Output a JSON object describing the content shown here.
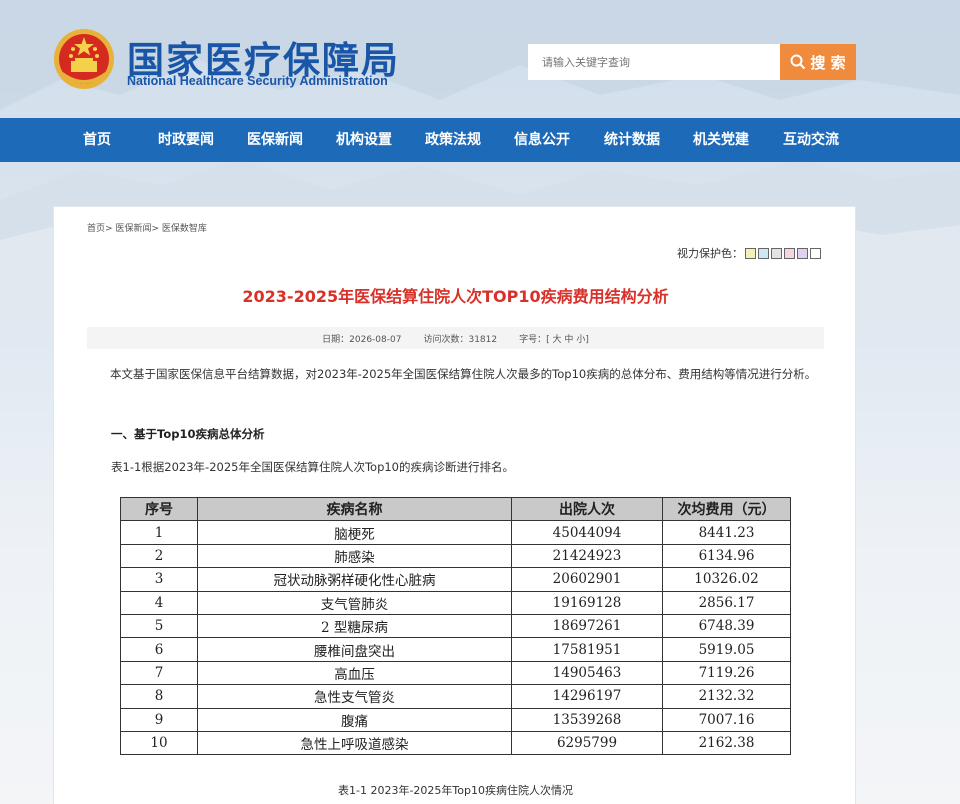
{
  "header": {
    "logo_cn": "国家医疗保障局",
    "logo_en": "National Healthcare Security Administration",
    "search_placeholder": "请输入关键字查询",
    "search_button": "搜 索"
  },
  "nav": {
    "items": [
      {
        "label": "首页"
      },
      {
        "label": "时政要闻"
      },
      {
        "label": "医保新闻"
      },
      {
        "label": "机构设置"
      },
      {
        "label": "政策法规"
      },
      {
        "label": "信息公开"
      },
      {
        "label": "统计数据"
      },
      {
        "label": "机关党建"
      },
      {
        "label": "互动交流"
      }
    ]
  },
  "breadcrumb": {
    "items": [
      "首页",
      "医保新闻",
      "医保数智库"
    ],
    "separator": ">"
  },
  "eye_care": {
    "label": "视力保护色：",
    "colors": [
      "#f5f0b8",
      "#cfe6f3",
      "#e3e3e3",
      "#f5d5e0",
      "#e2d0f0",
      "#ffffff"
    ]
  },
  "article": {
    "title": "2023-2025年医保结算住院人次TOP10疾病费用结构分析",
    "date_label": "日期：",
    "date": "2026-08-07",
    "visits_label": "访问次数：",
    "visits": "31812",
    "font_label": "字号：",
    "font_open": "[",
    "font_sizes": [
      "大",
      "中",
      "小"
    ],
    "font_close": "]",
    "intro": "本文基于国家医保信息平台结算数据，对2023年-2025年全国医保结算住院人次最多的Top10疾病的总体分布、费用结构等情况进行分析。",
    "section1": "一、基于Top10疾病总体分析",
    "table_intro": "表1-1根据2023年-2025年全国医保结算住院人次Top10的疾病诊断进行排名。",
    "table": {
      "headers": [
        "序号",
        "疾病名称",
        "出院人次",
        "次均费用（元）"
      ],
      "rows": [
        [
          "1",
          "脑梗死",
          "45044094",
          "8441.23"
        ],
        [
          "2",
          "肺感染",
          "21424923",
          "6134.96"
        ],
        [
          "3",
          "冠状动脉粥样硬化性心脏病",
          "20602901",
          "10326.02"
        ],
        [
          "4",
          "支气管肺炎",
          "19169128",
          "2856.17"
        ],
        [
          "5",
          "2 型糖尿病",
          "18697261",
          "6748.39"
        ],
        [
          "6",
          "腰椎间盘突出",
          "17581951",
          "5919.05"
        ],
        [
          "7",
          "高血压",
          "14905463",
          "7119.26"
        ],
        [
          "8",
          "急性支气管炎",
          "14296197",
          "2132.32"
        ],
        [
          "9",
          "腹痛",
          "13539268",
          "7007.16"
        ],
        [
          "10",
          "急性上呼吸道感染",
          "6295799",
          "2162.38"
        ]
      ]
    },
    "caption": "表1-1 2023年-2025年Top10疾病住院人次情况"
  }
}
